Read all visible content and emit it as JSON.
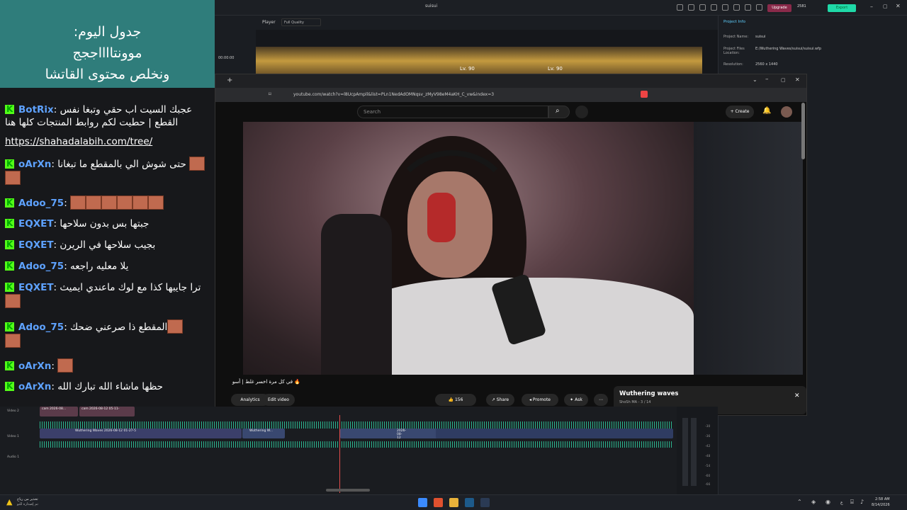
{
  "editor": {
    "project_name_title": "suisui",
    "upgrade_label": "Upgrade",
    "credits": "2581",
    "export_label": "Export",
    "player_label": "Player",
    "quality": "Full Quality",
    "time_badge": "00:00:00",
    "level_left": "Lv. 90",
    "level_right": "Lv. 90",
    "project_info_tab": "Project Info",
    "project_name_label": "Project Name:",
    "project_name_value": "suisui",
    "project_files_label": "Project Files Location:",
    "project_files_value": "E:/Wuthering Waves/suisui/suisui.wfp",
    "resolution_label": "Resolution:",
    "resolution_value": "2560 x 1440"
  },
  "overlay": {
    "line1": "جدول اليوم:",
    "line2": "موونتااااججج",
    "line3": "ونخلص محتوى القاتشا"
  },
  "chat": {
    "messages": [
      {
        "user": "BotRix",
        "text": "عجبك السيت اب حقي وتبغا نفس القطع | حطيت لكم روابط المنتجات كلها هنا"
      },
      {
        "user": "",
        "text": "https://shahadalabih.com/tree/"
      },
      {
        "user": "oArXn",
        "text": "حتى شوش الي بالمقطع ما تبغانا"
      },
      {
        "user": "Adoo_75",
        "text": ""
      },
      {
        "user": "EQXET",
        "text": "جبتها بس بدون سلاحها"
      },
      {
        "user": "EQXET",
        "text": "بجيب سلاحها في الريرن"
      },
      {
        "user": "Adoo_75",
        "text": "يلا معليه راجعه"
      },
      {
        "user": "EQXET",
        "text": "ترا جايبها كذا مع لوك ماعندي ايميث"
      },
      {
        "user": "Adoo_75",
        "text": "المقطع ذا صرعني ضحك"
      },
      {
        "user": "oArXn",
        "text": ""
      },
      {
        "user": "oArXn",
        "text": "حظها ماشاء الله تبارك الله"
      }
    ]
  },
  "browser": {
    "url": "youtube.com/watch?v=l8UcpAmpll&list=PLn1NedAdOMNqsv_zMyV98eM4aKH_C_vw&index=3",
    "search_placeholder": "Search",
    "create_label": "Create",
    "video_title": "🔥 في كل مرة اخسر غلط | أسو",
    "likes": "156",
    "share_label": "Share",
    "promote_label": "Promote",
    "ask_label": "Ask",
    "analytics_label": "Analytics",
    "edit_video_label": "Edit video",
    "playlist_title": "Wuthering waves",
    "playlist_sub": "ShoSh MA - 3 / 14"
  },
  "timeline": {
    "video2_label": "Video 2",
    "video1_label": "Video 1",
    "audio1_label": "Audio 1",
    "clip_a": "cam 2026-08...",
    "clip_b": "cam 2026-08-12 05-11-",
    "clip_c": "Wuthering Waves 2026-08-12 01-27-5",
    "clip_d": "Wuthering W...",
    "clip_e": "2026-08-12 01-27-19",
    "db_marks": [
      "-30",
      "-36",
      "-42",
      "-48",
      "-54",
      "-60",
      "-66"
    ]
  },
  "taskbar": {
    "warn_line1": "تحذير من رياح",
    "warn_line2": "تم إصداره للتو",
    "time": "2:58 AM",
    "date": "8/14/2026",
    "lang": "ع"
  }
}
